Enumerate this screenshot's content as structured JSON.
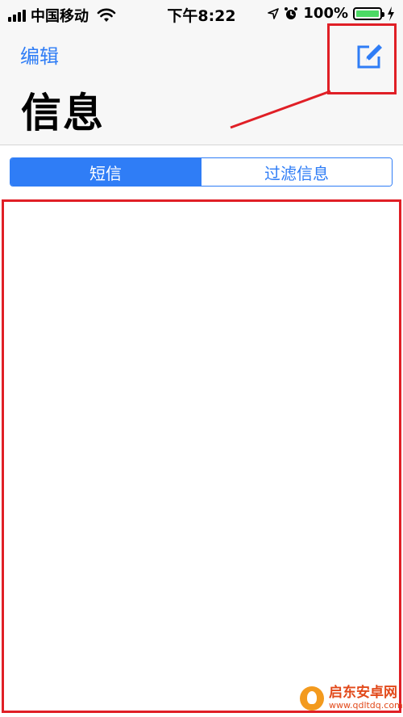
{
  "status_bar": {
    "carrier": "中国移动",
    "time": "下午8:22",
    "battery_percent": "100%",
    "battery_level": 1.0,
    "battery_color": "#4cd964"
  },
  "nav": {
    "edit_label": "编辑",
    "title": "信息",
    "compose_icon": "compose-icon"
  },
  "segmented": {
    "tabs": [
      {
        "label": "短信",
        "selected": true
      },
      {
        "label": "过滤信息",
        "selected": false
      }
    ]
  },
  "colors": {
    "accent": "#2f7df6",
    "annotation": "#e01f26"
  },
  "watermark": {
    "title": "启东安卓网",
    "url": "www.qdltdq.com"
  }
}
